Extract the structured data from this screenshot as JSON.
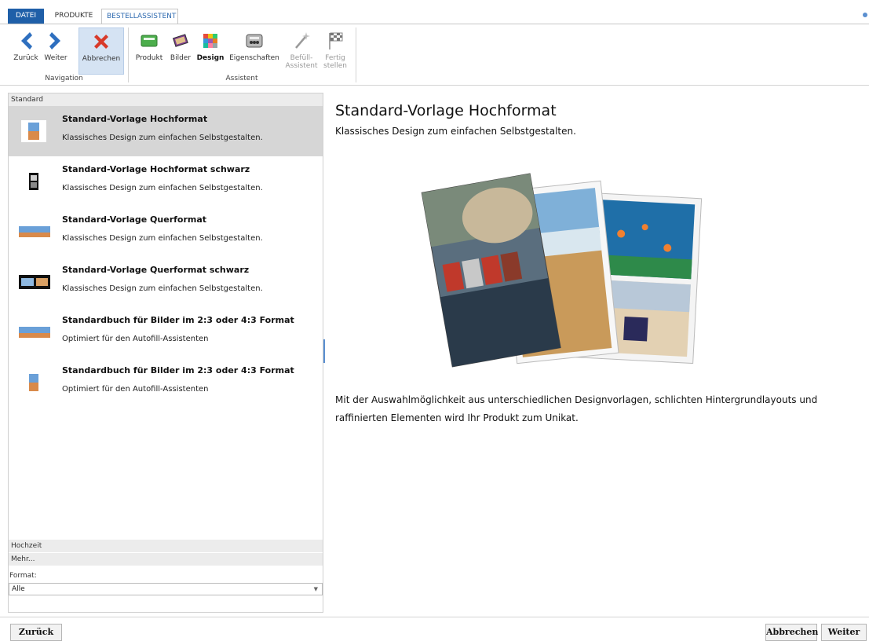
{
  "tabs": [
    {
      "label": "DATEI"
    },
    {
      "label": "PRODUKTE"
    },
    {
      "label": "BESTELLASSISTENT"
    }
  ],
  "ribbon": {
    "navigation": {
      "label": "Navigation",
      "back": "Zurück",
      "next": "Weiter",
      "cancel": "Abbrechen"
    },
    "assistant": {
      "label": "Assistent",
      "product": "Produkt",
      "pictures": "Bilder",
      "design": "Design",
      "properties": "Eigenschaften",
      "fill_line1": "Befüll-",
      "fill_line2": "Assistent",
      "finish_line1": "Fertig",
      "finish_line2": "stellen"
    }
  },
  "left": {
    "category": "Standard",
    "templates": [
      {
        "title": "Standard-Vorlage Hochformat",
        "description": "Klassisches Design zum einfachen Selbstgestalten."
      },
      {
        "title": "Standard-Vorlage Hochformat schwarz",
        "description": "Klassisches Design zum einfachen Selbstgestalten."
      },
      {
        "title": "Standard-Vorlage Querformat",
        "description": "Klassisches Design zum einfachen Selbstgestalten."
      },
      {
        "title": "Standard-Vorlage Querformat schwarz",
        "description": "Klassisches Design zum einfachen Selbstgestalten."
      },
      {
        "title": "Standardbuch für Bilder im 2:3 oder 4:3 Format",
        "description": "Optimiert für den Autofill-Assistenten"
      },
      {
        "title": "Standardbuch für Bilder im 2:3 oder 4:3 Format",
        "description": "Optimiert für den Autofill-Assistenten"
      }
    ],
    "more_categories": [
      "Hochzeit",
      "Mehr..."
    ],
    "format_label": "Format:",
    "format_value": "Alle"
  },
  "detail": {
    "title": "Standard-Vorlage Hochformat",
    "subtitle": "Klassisches Design zum einfachen Selbstgestalten.",
    "body": "Mit der Auswahlmöglichkeit aus unterschiedlichen Designvorlagen, schlichten Hintergrundlayouts und raffinierten Elementen wird Ihr Produkt zum Unikat."
  },
  "footer": {
    "back": "Zurück",
    "cancel": "Abbrechen",
    "next": "Weiter"
  },
  "colors": {
    "accent": "#1f5fa8",
    "selected_row": "#d6d6d6",
    "cancel_red": "#d83a2a"
  }
}
